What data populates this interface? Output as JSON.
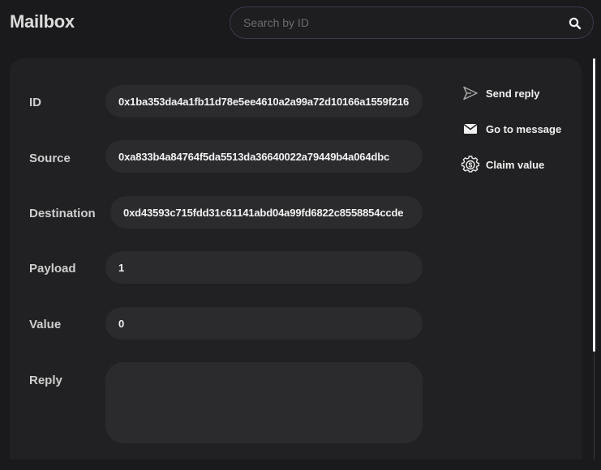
{
  "app": {
    "title": "Mailbox"
  },
  "search": {
    "placeholder": "Search by ID",
    "value": "",
    "icon": "search-icon"
  },
  "message": {
    "fields": [
      {
        "label": "ID",
        "value": "0x1ba353da4a1fb11d78e5ee4610a2a99a72d10166a1559f216"
      },
      {
        "label": "Source",
        "value": "0xa833b4a84764f5da5513da36640022a79449b4a064dbc"
      },
      {
        "label": "Destination",
        "value": "0xd43593c715fdd31c61141abd04a99fd6822c8558854ccde"
      },
      {
        "label": "Payload",
        "value": "1"
      },
      {
        "label": "Value",
        "value": "0"
      },
      {
        "label": "Reply",
        "value": ""
      }
    ]
  },
  "actions": [
    {
      "label": "Send reply",
      "icon": "send-icon"
    },
    {
      "label": "Go to message",
      "icon": "mail-icon"
    },
    {
      "label": "Claim value",
      "icon": "gear-dollar-icon"
    }
  ],
  "colors": {
    "page_bg": "#1a1a1c",
    "card_bg": "#212123",
    "field_bg": "#2b2b2e",
    "search_border": "#3b3b4f",
    "text": "#f2f2f2",
    "label": "#cfcfcf"
  }
}
